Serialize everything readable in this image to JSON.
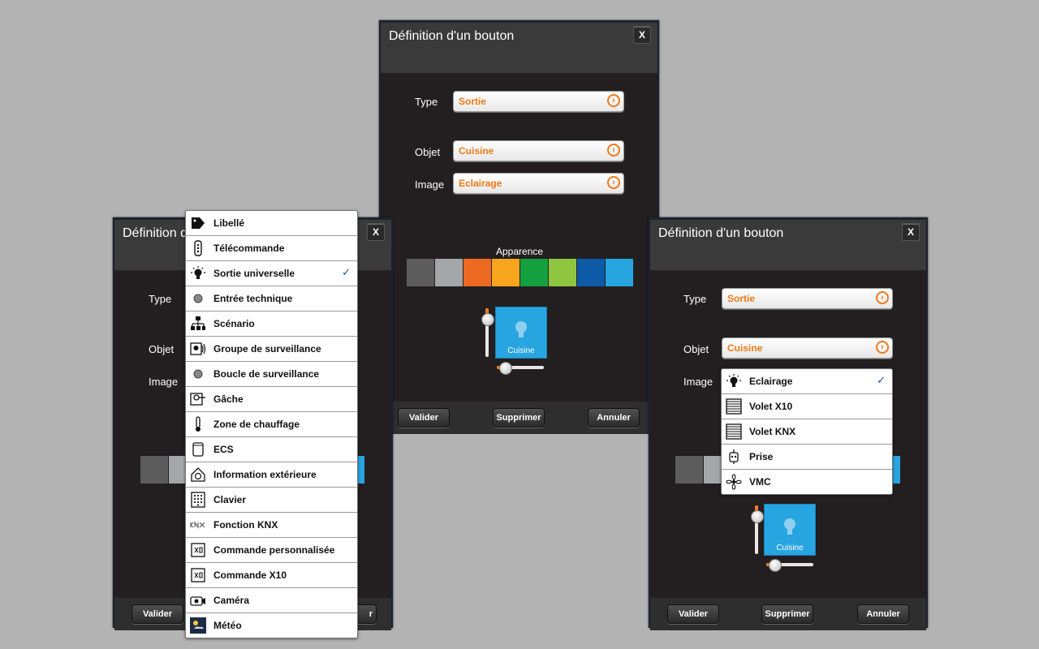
{
  "dialog_title": "Définition d'un bouton",
  "left_dialog_title": "Définition d",
  "close_label": "X",
  "labels": {
    "type": "Type",
    "objet": "Objet",
    "image": "Image",
    "apparence": "Apparence"
  },
  "fields": {
    "type_value": "Sortie",
    "objet_value": "Cuisine",
    "image_value": "Eclairage",
    "arrow_glyph": "›"
  },
  "buttons": {
    "valider": "Valider",
    "supprimer": "Supprimer",
    "annuler": "Annuler",
    "left_partial": "r"
  },
  "tile_label": "Cuisine",
  "swatch_colors": [
    "#5c5c5c",
    "#a4a7aa",
    "#ee6a22",
    "#f6a51c",
    "#16a141",
    "#8ec63f",
    "#0d5aa7",
    "#27a5e1"
  ],
  "accent_color": "#f07a1a",
  "type_menu": {
    "selected_index": 2,
    "check": "✓",
    "items": [
      {
        "label": "Libellé",
        "icon": "tag-icon"
      },
      {
        "label": "Télécommande",
        "icon": "remote-icon"
      },
      {
        "label": "Sortie universelle",
        "icon": "bulb-icon"
      },
      {
        "label": "Entrée technique",
        "icon": "dot-icon"
      },
      {
        "label": "Scénario",
        "icon": "tree-icon"
      },
      {
        "label": "Groupe de surveillance",
        "icon": "alarm-icon"
      },
      {
        "label": "Boucle de surveillance",
        "icon": "dot-icon"
      },
      {
        "label": "Gâche",
        "icon": "lock-icon"
      },
      {
        "label": "Zone de chauffage",
        "icon": "thermometer-icon"
      },
      {
        "label": "ECS",
        "icon": "tank-icon"
      },
      {
        "label": "Information extérieure",
        "icon": "house-info-icon"
      },
      {
        "label": "Clavier",
        "icon": "keypad-icon"
      },
      {
        "label": "Fonction KNX",
        "icon": "knx-icon"
      },
      {
        "label": "Commande personnalisée",
        "icon": "x10-icon"
      },
      {
        "label": "Commande X10",
        "icon": "x10-icon"
      },
      {
        "label": "Caméra",
        "icon": "camera-icon"
      },
      {
        "label": "Météo",
        "icon": "weather-icon"
      }
    ]
  },
  "image_menu": {
    "selected_index": 0,
    "check": "✓",
    "items": [
      {
        "label": "Eclairage",
        "icon": "bulb-icon"
      },
      {
        "label": "Volet X10",
        "icon": "shutter-icon"
      },
      {
        "label": "Volet KNX",
        "icon": "shutter-icon"
      },
      {
        "label": "Prise",
        "icon": "plug-icon"
      },
      {
        "label": "VMC",
        "icon": "fan-icon"
      }
    ]
  }
}
